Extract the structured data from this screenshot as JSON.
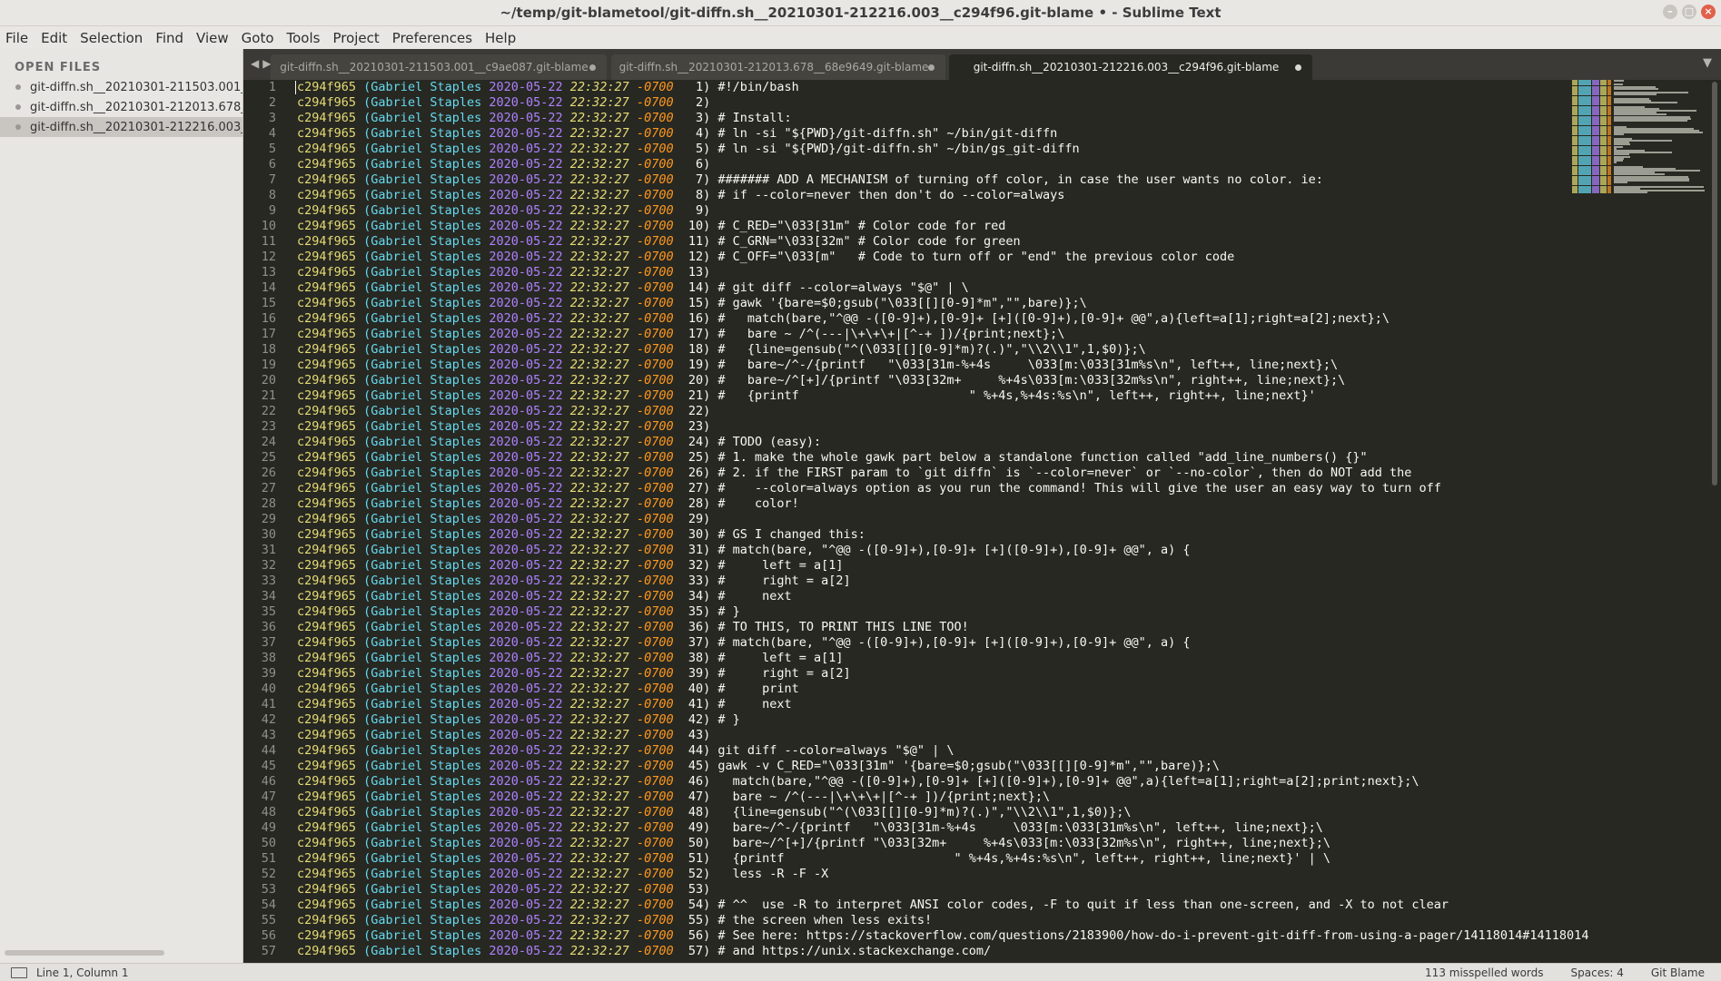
{
  "window": {
    "title": "~/temp/git-blametool/git-diffn.sh__20210301-212216.003__c294f96.git-blame • - Sublime Text"
  },
  "menu": [
    "File",
    "Edit",
    "Selection",
    "Find",
    "View",
    "Goto",
    "Tools",
    "Project",
    "Preferences",
    "Help"
  ],
  "sidebar": {
    "header": "OPEN FILES",
    "files": [
      {
        "name": "git-diffn.sh__20210301-211503.001__c9ae087.git-blame",
        "selected": false
      },
      {
        "name": "git-diffn.sh__20210301-212013.678__68e9649.git-blame",
        "selected": false
      },
      {
        "name": "git-diffn.sh__20210301-212216.003__c294f96.git-blame",
        "selected": true
      }
    ]
  },
  "tabs": [
    {
      "label": "git-diffn.sh__20210301-211503.001__c9ae087.git-blame",
      "active": false
    },
    {
      "label": "git-diffn.sh__20210301-212013.678__68e9649.git-blame",
      "active": false
    },
    {
      "label": "git-diffn.sh__20210301-212216.003__c294f96.git-blame",
      "active": true
    }
  ],
  "blame": {
    "hash": "c294f965",
    "author": "(Gabriel Staples",
    "date": "2020-05-22",
    "time": "22:32:27",
    "zone": "-0700"
  },
  "code_lines": [
    "#!/bin/bash",
    "",
    "# Install:",
    "# ln -si \"${PWD}/git-diffn.sh\" ~/bin/git-diffn",
    "# ln -si \"${PWD}/git-diffn.sh\" ~/bin/gs_git-diffn",
    "",
    "####### ADD A MECHANISM of turning off color, in case the user wants no color. ie:",
    "# if --color=never then don't do --color=always",
    "",
    "# C_RED=\"\\033[31m\" # Color code for red",
    "# C_GRN=\"\\033[32m\" # Color code for green",
    "# C_OFF=\"\\033[m\"   # Code to turn off or \"end\" the previous color code",
    "",
    "# git diff --color=always \"$@\" | \\",
    "# gawk '{bare=$0;gsub(\"\\033[[][0-9]*m\",\"\",bare)};\\",
    "#   match(bare,\"^@@ -([0-9]+),[0-9]+ [+]([0-9]+),[0-9]+ @@\",a){left=a[1];right=a[2];next};\\",
    "#   bare ~ /^(---|\\+\\+\\+|[^-+ ])/{print;next};\\",
    "#   {line=gensub(\"^(\\033[[][0-9]*m)?(.)\",\"\\\\2\\\\1\",1,$0)};\\",
    "#   bare~/^-/{printf   \"\\033[31m-%+4s     \\033[m:\\033[31m%s\\n\", left++, line;next};\\",
    "#   bare~/^[+]/{printf \"\\033[32m+     %+4s\\033[m:\\033[32m%s\\n\", right++, line;next};\\",
    "#   {printf                       \" %+4s,%+4s:%s\\n\", left++, right++, line;next}'",
    "",
    "",
    "# TODO (easy):",
    "# 1. make the whole gawk part below a standalone function called \"add_line_numbers() {}\"",
    "# 2. if the FIRST param to `git diffn` is `--color=never` or `--no-color`, then do NOT add the",
    "#    --color=always option as you run the command! This will give the user an easy way to turn off",
    "#    color!",
    "",
    "# GS I changed this:",
    "# match(bare, \"^@@ -([0-9]+),[0-9]+ [+]([0-9]+),[0-9]+ @@\", a) {",
    "#     left = a[1]",
    "#     right = a[2]",
    "#     next",
    "# }",
    "# TO THIS, TO PRINT THIS LINE TOO!",
    "# match(bare, \"^@@ -([0-9]+),[0-9]+ [+]([0-9]+),[0-9]+ @@\", a) {",
    "#     left = a[1]",
    "#     right = a[2]",
    "#     print",
    "#     next",
    "# }",
    "",
    "git diff --color=always \"$@\" | \\",
    "gawk -v C_RED=\"\\033[31m\" '{bare=$0;gsub(\"\\033[[][0-9]*m\",\"\",bare)};\\",
    "  match(bare,\"^@@ -([0-9]+),[0-9]+ [+]([0-9]+),[0-9]+ @@\",a){left=a[1];right=a[2];print;next};\\",
    "  bare ~ /^(---|\\+\\+\\+|[^-+ ])/{print;next};\\",
    "  {line=gensub(\"^(\\033[[][0-9]*m)?(.)\",\"\\\\2\\\\1\",1,$0)};\\",
    "  bare~/^-/{printf   \"\\033[31m-%+4s     \\033[m:\\033[31m%s\\n\", left++, line;next};\\",
    "  bare~/^[+]/{printf \"\\033[32m+     %+4s\\033[m:\\033[32m%s\\n\", right++, line;next};\\",
    "  {printf                       \" %+4s,%+4s:%s\\n\", left++, right++, line;next}' | \\",
    "  less -R -F -X",
    "",
    "# ^^  use -R to interpret ANSI color codes, -F to quit if less than one-screen, and -X to not clear",
    "# the screen when less exits!",
    "# See here: https://stackoverflow.com/questions/2183900/how-do-i-prevent-git-diff-from-using-a-pager/14118014#14118014",
    "# and https://unix.stackexchange.com/"
  ],
  "statusbar": {
    "position": "Line 1, Column 1",
    "misspelled": "113 misspelled words",
    "indent": "Spaces: 4",
    "syntax": "Git Blame"
  },
  "colors": {
    "editor_bg": "#272822",
    "hash": "#e6db74",
    "author": "#66d9ef",
    "date": "#ae81ff",
    "time": "#e6db74",
    "zone": "#fd971f",
    "text": "#f8f8f2"
  }
}
